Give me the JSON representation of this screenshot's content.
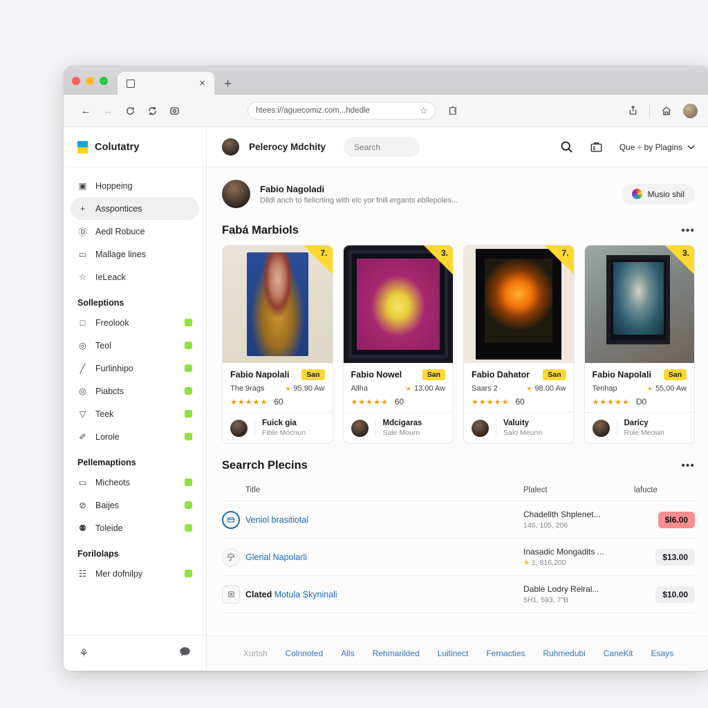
{
  "browser": {
    "tab_title": "",
    "tab_close_label": "×",
    "new_tab_label": "+",
    "back_label": "←",
    "forward_label": "→",
    "reload_label": "⟳",
    "refresh_label": "↻",
    "url": "htees:i//aguecomiz.com...hdedle",
    "bookmark_icon": "☆",
    "extension_icon": "⚇",
    "share_icon": "⇧",
    "home_icon": "⌂"
  },
  "sidebar": {
    "brand": "Colutatry",
    "items": [
      {
        "label": "Hoppeing",
        "icon": "▣",
        "active": false,
        "badge": false
      },
      {
        "label": "Asspontices",
        "icon": "+",
        "active": true,
        "badge": false
      },
      {
        "label": "Aedl Robuce",
        "icon": "Ⓓ",
        "active": false,
        "badge": false
      },
      {
        "label": "Mallage lines",
        "icon": "▭",
        "active": false,
        "badge": false
      },
      {
        "label": "IeLeack",
        "icon": "☆",
        "active": false,
        "badge": false
      }
    ],
    "group1_title": "Solleptions",
    "group1_items": [
      {
        "label": "Freolook",
        "icon": "□",
        "badge": true
      },
      {
        "label": "Teol",
        "icon": "◎",
        "badge": true
      },
      {
        "label": "Furlinhipo",
        "icon": "╱",
        "badge": true
      },
      {
        "label": "Piabcts",
        "icon": "◎",
        "badge": true
      },
      {
        "label": "Teek",
        "icon": "▽",
        "badge": true
      },
      {
        "label": "Lorole",
        "icon": "✐",
        "badge": true
      }
    ],
    "group2_title": "Pellemaptions",
    "group2_items": [
      {
        "label": "Micheots",
        "icon": "▭",
        "badge": true
      },
      {
        "label": "Baijes",
        "icon": "⊘",
        "badge": true
      },
      {
        "label": "Toleide",
        "icon": "⚉",
        "badge": true
      }
    ],
    "group3_title": "Forilolaps",
    "group3_items": [
      {
        "label": "Mer dofnilpy",
        "icon": "☷",
        "badge": true
      }
    ],
    "footer_left_icon": "⚘",
    "footer_right_icon": "●"
  },
  "header": {
    "user_name": "Pelerocy Mdchity",
    "search_placeholder": "Search",
    "search_icon": "search-icon",
    "briefcase_icon": "briefcase-icon",
    "dropdown_label": "Que ÷ by Plagins",
    "dropdown_caret": "⌄",
    "accent_color": "#f07d1e"
  },
  "profile": {
    "name": "Fabio Nagoladi",
    "description": "Dlldl anch to fielicrting with elc yor fnill ergants ebllepoles...",
    "button_label": "Musio shil"
  },
  "cards_section": {
    "title": "Fabá Marbiols",
    "more_label": "•••",
    "cards": [
      {
        "corner_number": "7.",
        "title": "Fabio Napolali",
        "tag": "San",
        "subtitle": "The 9rags",
        "price": "95.90 Aw",
        "stars": "★★★★★",
        "rating_count": "60",
        "author": "Fuick gia",
        "author_role": "Fible Mocnun"
      },
      {
        "corner_number": "3.",
        "title": "Fabio Nowel",
        "tag": "San",
        "subtitle": "Allha",
        "price": "13.00 Aw",
        "stars": "★★★★★",
        "rating_count": "60",
        "author": "Mdcigaras",
        "author_role": "Sale Mourn"
      },
      {
        "corner_number": "7.",
        "title": "Fabio Dahator",
        "tag": "San",
        "subtitle": "Saars 2",
        "price": "98.00 Aw",
        "stars": "★★★★★",
        "rating_count": "60",
        "author": "Valuity",
        "author_role": "Salo Meunn"
      },
      {
        "corner_number": "3.",
        "title": "Fabio Napolali",
        "tag": "San",
        "subtitle": "Tenhap",
        "price": "55,00 Aw",
        "stars": "★★★★★",
        "rating_count": "D0",
        "author": "Daricy",
        "author_role": "Role Meown"
      }
    ]
  },
  "table_section": {
    "title": "Searrch Plecins",
    "more_label": "•••",
    "columns": {
      "title": "Title",
      "project": "Plalect",
      "price": "lafucte"
    },
    "rows": [
      {
        "icon_style": "ring",
        "title_dark": "",
        "title_link": "Veniol brasitiotal",
        "project": "Chadellth Shplenet...",
        "project_sub": "146, 105, 206",
        "project_sub_star": false,
        "price": "$l6.00",
        "price_alert": true
      },
      {
        "icon_style": "grey",
        "title_dark": "",
        "title_link": "Glerial Napolarli",
        "project": "Inasadic Mongadits ...",
        "project_sub": "1, 816,200",
        "project_sub_star": true,
        "price": "$13.00",
        "price_alert": false
      },
      {
        "icon_style": "square",
        "title_dark": "Clated",
        "title_link": "Motula Skyninali",
        "project": "Dable Lodry Relral...",
        "project_sub": "5H1, 593, 7\"B",
        "project_sub_star": false,
        "price": "$10.00",
        "price_alert": false
      }
    ]
  },
  "page_footer": {
    "links": [
      {
        "label": "Xurtsh",
        "muted": true
      },
      {
        "label": "Colnnoted",
        "muted": false
      },
      {
        "label": "Alls",
        "muted": false
      },
      {
        "label": "Rehmarilded",
        "muted": false
      },
      {
        "label": "Luitinect",
        "muted": false
      },
      {
        "label": "Fernacties",
        "muted": false
      },
      {
        "label": "Ruhmedubi",
        "muted": false
      },
      {
        "label": "CaneKit",
        "muted": false
      },
      {
        "label": "Esays",
        "muted": false
      }
    ]
  }
}
